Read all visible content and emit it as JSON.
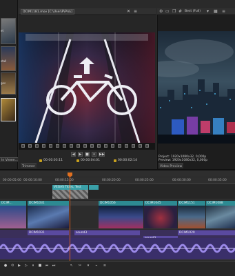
{
  "trimmer": {
    "file_title": "DCIM1181.mov  [C:\\User\\P\\Pro\\]",
    "tab_label": "Trimmer",
    "times": [
      "00:00:03:11",
      "00:00:04:01",
      "00:00:02:14"
    ],
    "controls": [
      "◀",
      "▶",
      "■",
      "⏸",
      "▶▶"
    ]
  },
  "preview": {
    "quality": "Best (Full)",
    "project_label": "Project:",
    "project_value": "1920x1080x32, 0,000p",
    "preview_label": "Preview:",
    "preview_value": "1920x1080x32, 0,000p",
    "tab_label": "Video Preview"
  },
  "left_panel": {
    "labels": [
      "et",
      "stall",
      "ges"
    ],
    "tab_label": "In Viewe..."
  },
  "timeline": {
    "ruler_labels": [
      "00:00:05:00",
      "00:00:10:00",
      "00:00:15:00",
      "00:00:20:00",
      "00:00:25:00",
      "00:00:30:00",
      "00:00:35:00"
    ],
    "title_clip": "VEGAS Titles, Text",
    "video_clips": [
      "DCIM...",
      "DCIM1031",
      "DCIM1056",
      "DCIM1045",
      "DCIM1151",
      "DCIM1088"
    ],
    "sound_clips": [
      "DCIM1031",
      "sound3",
      "sound3",
      "DCIM1020"
    ]
  },
  "colors": {
    "accent": "#e07020",
    "video_clip": "#3aa0a8",
    "audio_clip": "#5a4aa0",
    "waveform": "#8878d8"
  }
}
